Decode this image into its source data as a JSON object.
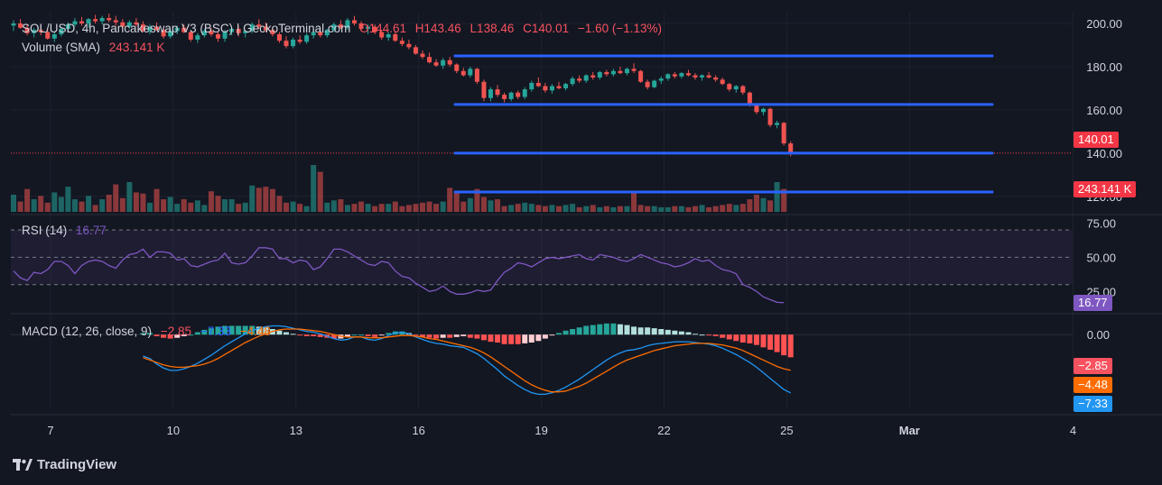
{
  "header": {
    "symbol": "SOL/USD, 4h, Pancakeswap V3 (BSC) | GeckoTerminal.com",
    "open": "O144.61",
    "high": "H143.46",
    "low": "L138.46",
    "close": "C140.01",
    "change": "−1.60 (−1.13%)",
    "volume_label": "Volume (SMA)",
    "volume_value": "243.141 K"
  },
  "rsi": {
    "label": "RSI (14)",
    "value": "16.77"
  },
  "macd": {
    "label": "MACD (12, 26, close, 9)",
    "hist": "−2.85",
    "macd": "−7.33",
    "signal": "−4.48"
  },
  "badges": {
    "price": "140.01",
    "volume": "243.141 K",
    "rsi": "16.77",
    "hist": "−2.85",
    "signal": "−4.48",
    "macd": "−7.33"
  },
  "brand": "TradingView",
  "colors": {
    "up": "#26a69a",
    "down": "#ef5350",
    "level": "#2962ff",
    "rsi": "#7e57c2",
    "macd": "#2196f3",
    "signal": "#ff6d00"
  },
  "chart_data": {
    "type": "candlestick",
    "timeframe": "4h",
    "x_axis_ticks": [
      "7",
      "10",
      "13",
      "16",
      "19",
      "22",
      "25",
      "Mar",
      "4"
    ],
    "price_axis_ticks": [
      200,
      180,
      160,
      140,
      120
    ],
    "price_range": [
      112,
      205
    ],
    "horizontal_levels": [
      185,
      162.5,
      140,
      122
    ],
    "last_price": 140.01,
    "rsi_axis_ticks": [
      75,
      50,
      25
    ],
    "rsi_range": [
      10,
      80
    ],
    "rsi_bands": [
      70,
      30
    ],
    "macd_axis_ticks": [
      0
    ],
    "macd_range": [
      -9.5,
      2.4
    ],
    "candles": [
      [
        199.0,
        201.5,
        196.5,
        200.0
      ],
      [
        200.0,
        202.0,
        197.5,
        198.0
      ],
      [
        198.0,
        199.5,
        194.5,
        195.5
      ],
      [
        195.5,
        198.0,
        193.5,
        197.0
      ],
      [
        197.0,
        199.0,
        194.5,
        196.0
      ],
      [
        196.0,
        197.5,
        192.5,
        193.0
      ],
      [
        193.0,
        196.0,
        191.5,
        195.0
      ],
      [
        195.0,
        198.5,
        194.0,
        197.5
      ],
      [
        197.5,
        200.5,
        196.0,
        199.5
      ],
      [
        199.5,
        202.5,
        198.5,
        201.0
      ],
      [
        201.0,
        203.0,
        199.0,
        200.0
      ],
      [
        200.0,
        202.5,
        198.0,
        202.0
      ],
      [
        202.0,
        204.0,
        200.0,
        201.0
      ],
      [
        201.0,
        203.5,
        199.5,
        202.5
      ],
      [
        202.5,
        204.5,
        200.5,
        201.5
      ],
      [
        201.5,
        203.5,
        199.0,
        200.5
      ],
      [
        200.5,
        202.0,
        197.5,
        198.5
      ],
      [
        198.5,
        201.5,
        197.5,
        200.5
      ],
      [
        200.5,
        202.5,
        198.5,
        199.5
      ],
      [
        199.5,
        201.0,
        196.0,
        196.5
      ],
      [
        196.5,
        199.5,
        195.0,
        198.5
      ],
      [
        198.5,
        200.5,
        196.5,
        197.0
      ],
      [
        197.0,
        198.0,
        193.0,
        194.0
      ],
      [
        194.0,
        197.5,
        193.0,
        196.5
      ],
      [
        196.5,
        199.0,
        195.0,
        198.0
      ],
      [
        198.0,
        199.5,
        195.5,
        196.0
      ],
      [
        196.0,
        196.5,
        191.5,
        192.5
      ],
      [
        192.5,
        195.5,
        191.0,
        194.5
      ],
      [
        194.5,
        197.5,
        193.5,
        196.5
      ],
      [
        196.5,
        198.0,
        194.0,
        195.0
      ],
      [
        195.0,
        196.0,
        191.5,
        193.0
      ],
      [
        193.0,
        197.0,
        191.5,
        196.0
      ],
      [
        196.0,
        198.5,
        194.5,
        197.5
      ],
      [
        197.5,
        199.0,
        194.0,
        195.5
      ],
      [
        195.5,
        197.0,
        193.5,
        196.5
      ],
      [
        196.5,
        200.5,
        195.5,
        199.5
      ],
      [
        199.5,
        202.0,
        197.5,
        198.5
      ],
      [
        198.5,
        200.5,
        196.0,
        197.0
      ],
      [
        197.0,
        198.5,
        194.0,
        195.0
      ],
      [
        195.0,
        196.0,
        191.0,
        192.0
      ],
      [
        192.0,
        194.0,
        188.5,
        189.5
      ],
      [
        189.5,
        193.5,
        188.5,
        192.5
      ],
      [
        192.5,
        194.5,
        190.5,
        191.5
      ],
      [
        191.5,
        195.5,
        190.5,
        194.5
      ],
      [
        194.5,
        197.0,
        193.0,
        196.0
      ],
      [
        196.0,
        198.0,
        193.5,
        194.5
      ],
      [
        194.5,
        197.5,
        193.5,
        197.0
      ],
      [
        197.0,
        200.5,
        196.0,
        199.5
      ],
      [
        199.5,
        201.5,
        197.5,
        198.0
      ],
      [
        198.0,
        202.5,
        197.0,
        201.5
      ],
      [
        201.5,
        203.5,
        199.0,
        200.0
      ],
      [
        200.0,
        201.0,
        196.5,
        197.5
      ],
      [
        197.5,
        199.5,
        195.0,
        198.5
      ],
      [
        198.5,
        199.5,
        195.0,
        196.0
      ],
      [
        196.0,
        197.0,
        192.5,
        193.5
      ],
      [
        193.5,
        196.0,
        192.0,
        195.0
      ],
      [
        195.0,
        196.5,
        191.5,
        192.0
      ],
      [
        192.0,
        193.5,
        189.5,
        190.5
      ],
      [
        190.5,
        192.5,
        188.0,
        189.0
      ],
      [
        189.0,
        190.0,
        185.5,
        186.0
      ],
      [
        186.0,
        187.5,
        183.5,
        184.5
      ],
      [
        184.5,
        186.5,
        181.5,
        182.0
      ],
      [
        182.0,
        183.5,
        180.0,
        180.5
      ],
      [
        180.5,
        184.0,
        179.0,
        183.0
      ],
      [
        183.0,
        184.5,
        180.0,
        181.0
      ],
      [
        181.0,
        181.5,
        177.0,
        178.0
      ],
      [
        178.0,
        179.5,
        175.5,
        176.0
      ],
      [
        176.0,
        180.0,
        175.0,
        179.0
      ],
      [
        179.0,
        179.5,
        172.0,
        173.0
      ],
      [
        173.0,
        174.0,
        164.0,
        165.5
      ],
      [
        165.5,
        170.5,
        164.0,
        169.5
      ],
      [
        169.5,
        171.5,
        166.0,
        167.0
      ],
      [
        167.0,
        168.0,
        163.5,
        165.0
      ],
      [
        165.0,
        168.5,
        164.0,
        168.0
      ],
      [
        168.0,
        169.0,
        165.0,
        166.0
      ],
      [
        166.0,
        170.5,
        165.0,
        169.5
      ],
      [
        169.5,
        173.5,
        168.5,
        172.5
      ],
      [
        172.5,
        175.0,
        170.5,
        171.0
      ],
      [
        171.0,
        172.5,
        168.0,
        169.0
      ],
      [
        169.0,
        172.0,
        167.5,
        171.0
      ],
      [
        171.0,
        173.0,
        169.5,
        170.0
      ],
      [
        170.0,
        172.5,
        169.0,
        172.0
      ],
      [
        172.0,
        175.5,
        171.0,
        174.5
      ],
      [
        174.5,
        176.0,
        172.5,
        173.5
      ],
      [
        173.5,
        176.5,
        172.5,
        176.0
      ],
      [
        176.0,
        177.5,
        174.0,
        175.0
      ],
      [
        175.0,
        178.0,
        174.0,
        177.5
      ],
      [
        177.5,
        178.5,
        175.5,
        176.5
      ],
      [
        176.5,
        179.0,
        175.5,
        178.0
      ],
      [
        178.0,
        180.0,
        176.5,
        177.0
      ],
      [
        177.0,
        179.5,
        176.0,
        179.0
      ],
      [
        179.0,
        181.5,
        177.0,
        178.0
      ],
      [
        178.0,
        178.5,
        172.5,
        173.0
      ],
      [
        173.0,
        174.0,
        169.5,
        170.5
      ],
      [
        170.5,
        174.0,
        170.0,
        173.5
      ],
      [
        173.5,
        175.5,
        172.0,
        174.5
      ],
      [
        174.5,
        177.0,
        173.5,
        176.5
      ],
      [
        176.5,
        177.5,
        174.5,
        175.5
      ],
      [
        175.5,
        177.5,
        174.5,
        177.0
      ],
      [
        177.0,
        178.5,
        175.5,
        176.0
      ],
      [
        176.0,
        177.0,
        174.0,
        175.0
      ],
      [
        175.0,
        176.5,
        173.5,
        176.0
      ],
      [
        176.0,
        177.5,
        174.5,
        175.0
      ],
      [
        175.0,
        176.0,
        173.0,
        174.0
      ],
      [
        174.0,
        175.0,
        171.5,
        172.0
      ],
      [
        172.0,
        172.5,
        168.5,
        169.5
      ],
      [
        169.5,
        171.5,
        168.0,
        171.0
      ],
      [
        171.0,
        171.5,
        167.0,
        168.0
      ],
      [
        168.0,
        168.5,
        161.5,
        162.5
      ],
      [
        162.5,
        163.0,
        158.0,
        159.0
      ],
      [
        159.0,
        161.0,
        157.5,
        160.5
      ],
      [
        160.5,
        161.0,
        152.0,
        153.0
      ],
      [
        153.0,
        155.0,
        151.5,
        154.0
      ],
      [
        154.0,
        154.5,
        143.5,
        144.5
      ],
      [
        144.5,
        145.5,
        138.5,
        140.0
      ]
    ],
    "volume": [
      30,
      18,
      40,
      22,
      28,
      16,
      34,
      26,
      44,
      22,
      18,
      28,
      12,
      22,
      30,
      48,
      24,
      52,
      34,
      32,
      16,
      40,
      22,
      26,
      14,
      22,
      16,
      20,
      12,
      36,
      28,
      22,
      22,
      14,
      16,
      46,
      42,
      44,
      40,
      28,
      16,
      18,
      14,
      10,
      82,
      70,
      16,
      20,
      22,
      12,
      14,
      18,
      14,
      10,
      14,
      14,
      18,
      10,
      12,
      14,
      16,
      18,
      14,
      18,
      42,
      34,
      18,
      24,
      40,
      26,
      20,
      22,
      10,
      12,
      14,
      16,
      14,
      12,
      10,
      12,
      10,
      12,
      14,
      8,
      10,
      12,
      8,
      10,
      8,
      10,
      10,
      36,
      12,
      10,
      10,
      8,
      8,
      10,
      10,
      8,
      10,
      12,
      8,
      10,
      12,
      14,
      12,
      14,
      22,
      30,
      24,
      20,
      52,
      40
    ],
    "rsi": [
      40,
      35,
      33,
      39,
      38,
      41,
      47,
      47,
      44,
      38,
      44,
      47,
      48,
      47,
      44,
      42,
      48,
      52,
      53,
      56,
      50,
      54,
      54,
      53,
      48,
      49,
      44,
      43,
      45,
      47,
      48,
      53,
      46,
      45,
      46,
      51,
      57,
      57,
      56,
      49,
      49,
      46,
      48,
      47,
      41,
      43,
      49,
      56,
      56,
      54,
      51,
      48,
      45,
      44,
      47,
      46,
      40,
      36,
      35,
      31,
      28,
      25,
      26,
      29,
      25,
      23,
      23,
      24,
      26,
      25,
      26,
      33,
      39,
      42,
      46,
      45,
      43,
      46,
      49,
      50,
      49,
      50,
      51,
      52,
      49,
      48,
      52,
      51,
      50,
      48,
      47,
      49,
      52,
      50,
      48,
      46,
      45,
      43,
      44,
      46,
      49,
      47,
      48,
      44,
      41,
      40,
      38,
      30,
      28,
      25,
      21,
      19,
      17,
      16.77
    ],
    "macd_line": [
      -2.7,
      -3.0,
      -3.7,
      -4.2,
      -4.5,
      -4.5,
      -4.3,
      -4.0,
      -3.6,
      -3.1,
      -2.6,
      -2.0,
      -1.4,
      -0.9,
      -0.4,
      0.1,
      0.5,
      0.8,
      1.0,
      1.1,
      1.1,
      1.0,
      0.8,
      0.6,
      0.4,
      0.3,
      0.1,
      -0.2,
      -0.5,
      -0.7,
      -0.6,
      -0.3,
      -0.3,
      -0.6,
      -0.7,
      -0.5,
      -0.1,
      0.2,
      0.3,
      0.1,
      -0.3,
      -0.6,
      -0.9,
      -1.1,
      -1.2,
      -1.4,
      -1.5,
      -1.6,
      -2.0,
      -2.4,
      -3.0,
      -3.7,
      -4.4,
      -5.2,
      -5.8,
      -6.4,
      -6.9,
      -7.3,
      -7.5,
      -7.5,
      -7.3,
      -7.0,
      -6.6,
      -6.1,
      -5.6,
      -5.0,
      -4.4,
      -3.8,
      -3.2,
      -2.7,
      -2.3,
      -2.0,
      -1.9,
      -1.7,
      -1.4,
      -1.2,
      -1.1,
      -1.0,
      -0.9,
      -0.9,
      -0.9,
      -1.0,
      -1.1,
      -1.2,
      -1.4,
      -1.7,
      -2.1,
      -2.5,
      -3.0,
      -3.5,
      -4.1,
      -4.8,
      -5.5,
      -6.2,
      -6.9,
      -7.33
    ],
    "signal_line": [
      -2.9,
      -3.2,
      -3.5,
      -3.8,
      -4.0,
      -4.1,
      -4.1,
      -4.0,
      -3.9,
      -3.7,
      -3.4,
      -3.0,
      -2.5,
      -2.0,
      -1.5,
      -1.0,
      -0.6,
      -0.2,
      0.1,
      0.4,
      0.6,
      0.7,
      0.7,
      0.7,
      0.6,
      0.5,
      0.4,
      0.2,
      0.0,
      -0.2,
      -0.3,
      -0.3,
      -0.3,
      -0.4,
      -0.4,
      -0.4,
      -0.3,
      -0.2,
      -0.1,
      -0.1,
      -0.2,
      -0.3,
      -0.5,
      -0.6,
      -0.8,
      -1.0,
      -1.2,
      -1.4,
      -1.6,
      -1.9,
      -2.3,
      -2.8,
      -3.4,
      -4.0,
      -4.6,
      -5.2,
      -5.8,
      -6.3,
      -6.7,
      -7.0,
      -7.2,
      -7.2,
      -7.1,
      -6.8,
      -6.5,
      -6.1,
      -5.6,
      -5.1,
      -4.6,
      -4.1,
      -3.6,
      -3.2,
      -2.9,
      -2.6,
      -2.3,
      -2.0,
      -1.8,
      -1.6,
      -1.4,
      -1.3,
      -1.2,
      -1.1,
      -1.1,
      -1.1,
      -1.2,
      -1.3,
      -1.5,
      -1.7,
      -2.0,
      -2.4,
      -2.8,
      -3.2,
      -3.6,
      -4.0,
      -4.3,
      -4.48
    ]
  }
}
